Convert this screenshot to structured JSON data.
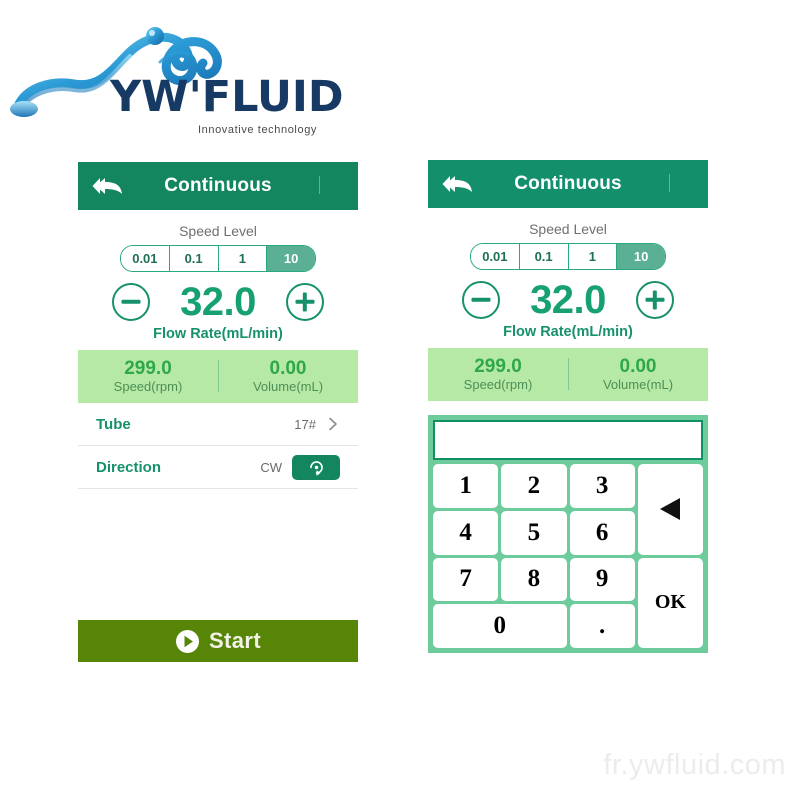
{
  "logo": {
    "wordmark": "YW'FLUID",
    "tagline": "Innovative  technology",
    "icon_name": "water-splash-logo"
  },
  "watermark": "fr.ywfluid.com",
  "colors": {
    "header_teal": "#13855f",
    "accent_green": "#18a170",
    "stats_bg": "#b7e9a6",
    "start_olive": "#568508",
    "keypad_bg": "#6ecb9c",
    "segment_selected": "#5aaf95"
  },
  "panel_left": {
    "header": {
      "title": "Continuous",
      "back_icon": "double-chevron-back-icon"
    },
    "speed_level": {
      "label": "Speed Level",
      "options": [
        "0.01",
        "0.1",
        "1",
        "10"
      ],
      "selected": "10"
    },
    "flow": {
      "minus_icon": "minus-circle-icon",
      "plus_icon": "plus-circle-icon",
      "value": "32.0",
      "unit_label": "Flow Rate(mL/min)"
    },
    "stats": [
      {
        "value": "299.0",
        "label": "Speed(rpm)"
      },
      {
        "value": "0.00",
        "label": "Volume(mL)"
      }
    ],
    "rows": [
      {
        "name": "Tube",
        "value": "17#",
        "icon": "chevron-right-icon"
      },
      {
        "name": "Direction",
        "value": "CW",
        "icon": "clockwise-rotation-icon"
      }
    ],
    "start": {
      "label": "Start",
      "icon": "play-circle-icon"
    }
  },
  "panel_right": {
    "header": {
      "title": "Continuous",
      "back_icon": "double-chevron-back-icon"
    },
    "speed_level": {
      "label": "Speed Level",
      "options": [
        "0.01",
        "0.1",
        "1",
        "10"
      ],
      "selected": "10"
    },
    "flow": {
      "minus_icon": "minus-circle-icon",
      "plus_icon": "plus-circle-icon",
      "value": "32.0",
      "unit_label": "Flow Rate(mL/min)"
    },
    "stats": [
      {
        "value": "299.0",
        "label": "Speed(rpm)"
      },
      {
        "value": "0.00",
        "label": "Volume(mL)"
      }
    ],
    "keypad": {
      "display_value": "",
      "keys": [
        "1",
        "2",
        "3",
        "4",
        "5",
        "6",
        "7",
        "8",
        "9"
      ],
      "zero": "0",
      "dot": ".",
      "backspace_icon": "backspace-arrow-icon",
      "ok": "OK"
    }
  }
}
